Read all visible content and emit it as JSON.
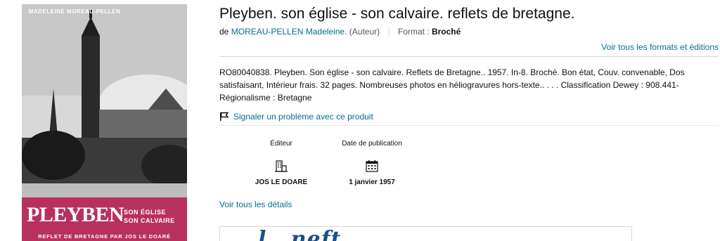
{
  "cover": {
    "author": "MADELEINE MOREAU-PELLEN",
    "title": "PLEYBEN",
    "subtitle_line1": "SON ÉGLISE",
    "subtitle_line2": "SON CALVAIRE",
    "footer": "REFLET DE BRETAGNE PAR JOS LE DOARÉ",
    "accent_color": "#b8315e"
  },
  "product": {
    "title": "Pleyben. son église - son calvaire. reflets de bretagne.",
    "by_prefix": "de",
    "author": "MOREAU-PELLEN Madeleine.",
    "author_role": "(Auteur)",
    "format_label": "Format :",
    "format_value": "Broché",
    "all_formats_link": "Voir tous les formats et éditions",
    "description": "RO80040838. Pleyben. Son église - son calvaire. Reflets de Bretagne.. 1957. In-8. Broché. Bon état, Couv. convenable, Dos satisfaisant, Intérieur frais. 32 pages. Nombreuses photos en héliogravures hors-texte.. . . . Classification Dewey : 908.441-Régionalisme : Bretagne",
    "report_link": "Signaler un problème avec ce produit",
    "report_icon": "flag-icon"
  },
  "attributes": [
    {
      "label": "Éditeur",
      "icon": "building-icon",
      "value": "JOS LE DOARE"
    },
    {
      "label": "Date de publication",
      "icon": "calendar-icon",
      "value": "1 janvier 1957"
    }
  ],
  "see_details_link": "Voir tous les détails",
  "ad": {
    "text": "l...neft"
  },
  "colors": {
    "link": "#007185",
    "text": "#0f1111",
    "muted": "#565959",
    "divider": "#d5d9d9"
  }
}
